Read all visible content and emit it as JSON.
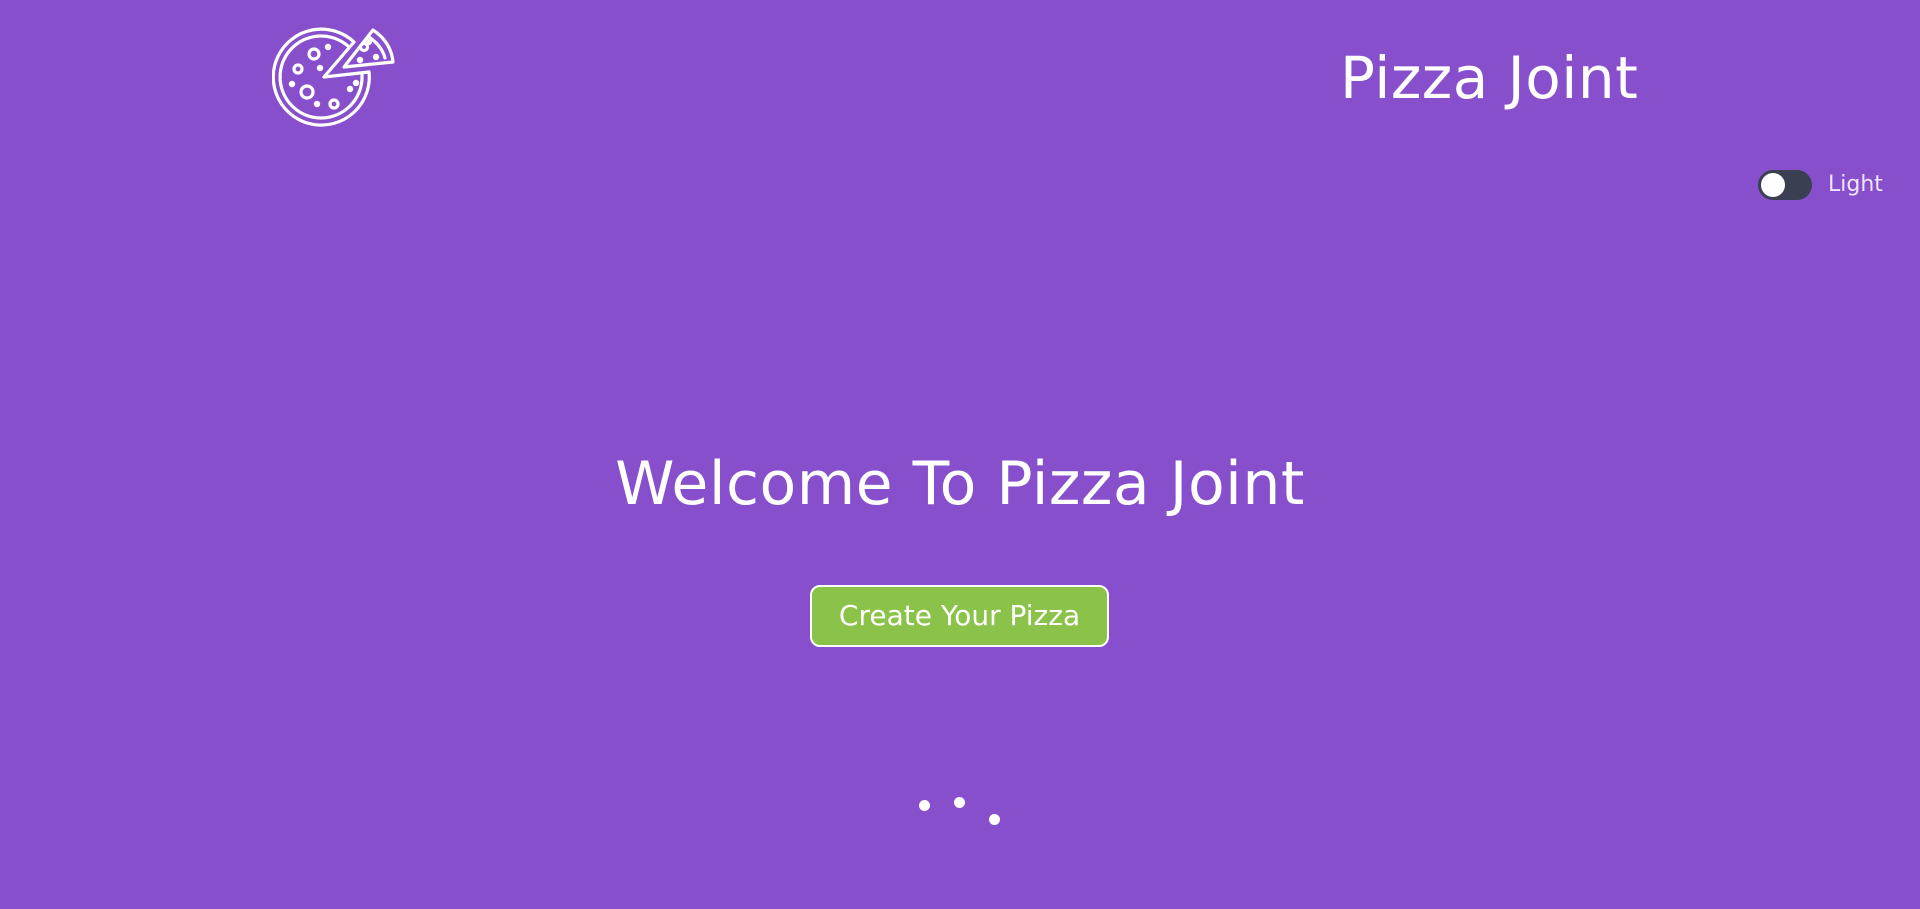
{
  "header": {
    "logo_icon": "pizza-icon",
    "title": "Pizza Joint"
  },
  "theme_toggle": {
    "label": "Light",
    "checked": false
  },
  "hero": {
    "title": "Welcome To Pizza Joint",
    "cta_label": "Create Your Pizza"
  },
  "loader": {
    "dot_count": 3
  },
  "colors": {
    "background": "#874fcc",
    "button": "#8bc34a",
    "switch_track": "#3a4052",
    "text": "#ffffff"
  }
}
